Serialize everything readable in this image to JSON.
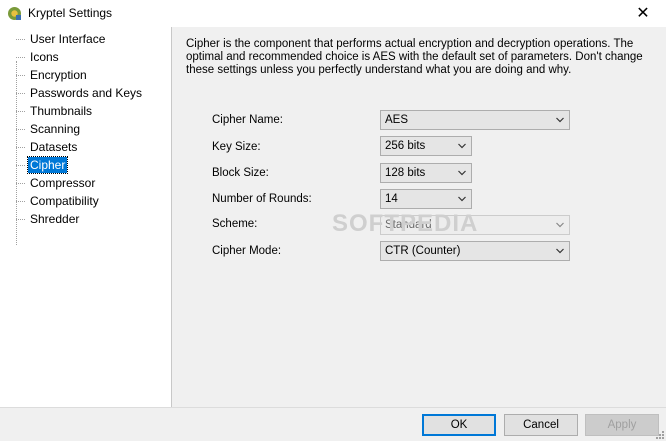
{
  "window": {
    "title": "Kryptel Settings",
    "close_glyph": "✕"
  },
  "sidebar": {
    "items": [
      {
        "label": "User Interface"
      },
      {
        "label": "Icons"
      },
      {
        "label": "Encryption"
      },
      {
        "label": "Passwords and Keys"
      },
      {
        "label": "Thumbnails"
      },
      {
        "label": "Scanning"
      },
      {
        "label": "Datasets"
      },
      {
        "label": "Cipher",
        "selected": true
      },
      {
        "label": "Compressor"
      },
      {
        "label": "Compatibility"
      },
      {
        "label": "Shredder"
      }
    ]
  },
  "main": {
    "description": "Cipher is the component that performs actual encryption and decryption operations. The optimal and recommended choice is AES with the default set of parameters. Don't change these settings unless you perfectly understand what you are doing and why.",
    "fields": [
      {
        "label": "Cipher Name:",
        "value": "AES"
      },
      {
        "label": "Key Size:",
        "value": "256 bits"
      },
      {
        "label": "Block Size:",
        "value": "128 bits"
      },
      {
        "label": "Number of Rounds:",
        "value": "14"
      },
      {
        "label": "Scheme:",
        "value": "Standard",
        "disabled": true
      },
      {
        "label": "Cipher Mode:",
        "value": "CTR (Counter)"
      }
    ],
    "watermark": "SOFTPEDIA"
  },
  "footer": {
    "ok_label": "OK",
    "cancel_label": "Cancel",
    "apply_label": "Apply"
  },
  "colors": {
    "accent": "#0078d7",
    "panel": "#f0f0f0"
  }
}
